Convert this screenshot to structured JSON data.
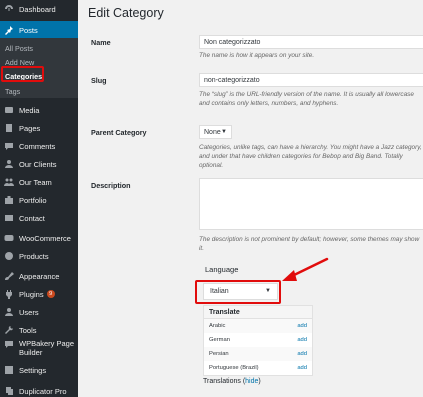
{
  "sidebar": {
    "dashboard": "Dashboard",
    "posts": "Posts",
    "sub": {
      "all_posts": "All Posts",
      "add_new": "Add New",
      "categories": "Categories",
      "tags": "Tags"
    },
    "items": {
      "media": "Media",
      "pages": "Pages",
      "comments": "Comments",
      "clients": "Our Clients",
      "team": "Our Team",
      "portfolio": "Portfolio",
      "contact": "Contact",
      "woocommerce": "WooCommerce",
      "products": "Products",
      "appearance": "Appearance",
      "plugins": "Plugins",
      "plugins_badge": "9",
      "users": "Users",
      "tools": "Tools",
      "wpbakery": "WPBakery Page Builder",
      "settings": "Settings",
      "duplicator": "Duplicator Pro"
    }
  },
  "main": {
    "title": "Edit Category",
    "name": {
      "label": "Name",
      "value": "Non categorizzato",
      "desc": "The name is how it appears on your site."
    },
    "slug": {
      "label": "Slug",
      "value": "non-categorizzato",
      "desc": "The “slug” is the URL-friendly version of the name. It is usually all lowercase and contains only letters, numbers, and hyphens."
    },
    "parent": {
      "label": "Parent Category",
      "value": "None",
      "desc": "Categories, unlike tags, can have a hierarchy. You might have a Jazz category, and under that have children categories for Bebop and Big Band. Totally optional."
    },
    "description": {
      "label": "Description",
      "value": "",
      "desc": "The description is not prominent by default; however, some themes may show it."
    },
    "language": {
      "label": "Language",
      "value": "Italian"
    },
    "translate": {
      "header": "Translate",
      "rows": [
        {
          "lang": "Arabic",
          "action": "add"
        },
        {
          "lang": "German",
          "action": "add"
        },
        {
          "lang": "Persian",
          "action": "add"
        },
        {
          "lang": "Portuguese (Brazil)",
          "action": "add"
        }
      ]
    },
    "translations": {
      "label": "Translations",
      "hide": "hide"
    }
  },
  "colors": {
    "sidebar_bg": "#23282d",
    "active": "#0073aa",
    "highlight": "#e10c0c"
  }
}
